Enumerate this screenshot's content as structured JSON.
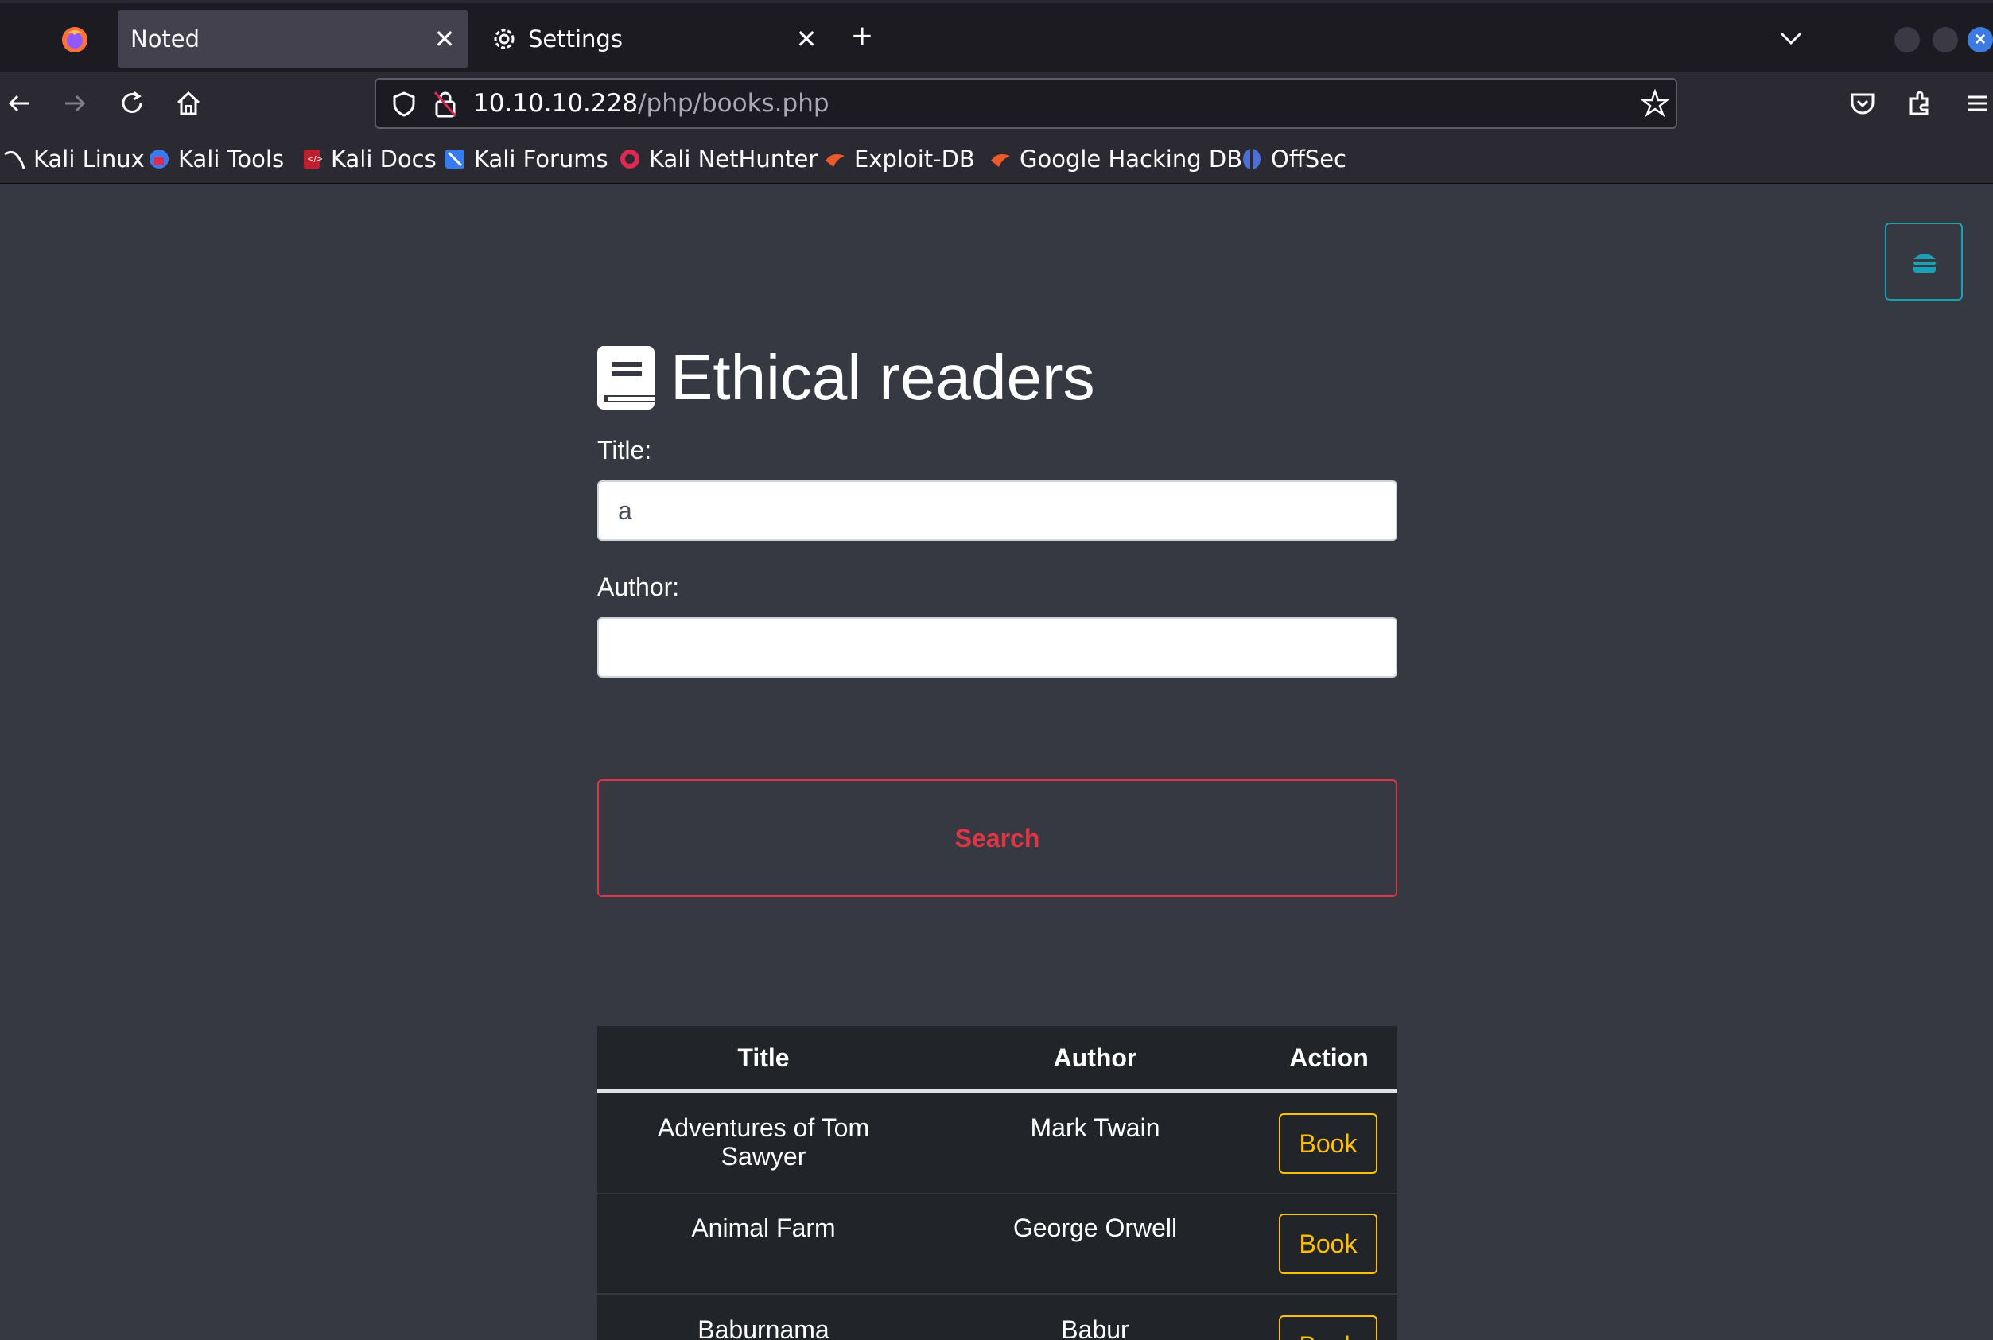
{
  "browser": {
    "tabs": [
      {
        "label": "Noted",
        "active": true
      },
      {
        "label": "Settings",
        "active": false
      }
    ],
    "url": {
      "host": "10.10.10.228",
      "path": "/php/books.php"
    },
    "bookmarks": [
      {
        "label": "Kali Linux",
        "icon": "kali-dragon-icon"
      },
      {
        "label": "Kali Tools",
        "icon": "kali-tools-icon"
      },
      {
        "label": "Kali Docs",
        "icon": "kali-docs-icon"
      },
      {
        "label": "Kali Forums",
        "icon": "kali-forums-icon"
      },
      {
        "label": "Kali NetHunter",
        "icon": "kali-nethunter-icon"
      },
      {
        "label": "Exploit-DB",
        "icon": "exploit-db-icon"
      },
      {
        "label": "Google Hacking DB",
        "icon": "ghdb-icon"
      },
      {
        "label": "OffSec",
        "icon": "offsec-icon"
      }
    ]
  },
  "page": {
    "title": "Ethical readers",
    "form": {
      "title_label": "Title:",
      "title_value": "a",
      "author_label": "Author:",
      "author_value": "",
      "search_label": "Search"
    },
    "table": {
      "headers": [
        "Title",
        "Author",
        "Action"
      ],
      "rows": [
        {
          "title": "Adventures of Tom Sawyer",
          "author": "Mark Twain",
          "action": "Book"
        },
        {
          "title": "Animal Farm",
          "author": "George Orwell",
          "action": "Book"
        },
        {
          "title": "Baburnama",
          "author": "Babur",
          "action": "Book"
        }
      ]
    }
  },
  "colors": {
    "page_bg": "#363942",
    "danger": "#dc3545",
    "warning": "#ffc107",
    "info": "#17a2b8",
    "table_bg": "#212529"
  }
}
